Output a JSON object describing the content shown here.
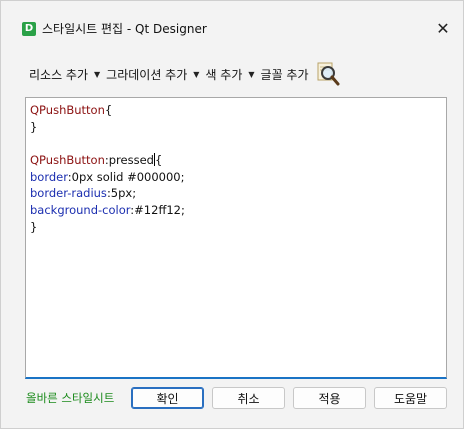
{
  "window": {
    "title": "스타일시트 편집 - Qt Designer",
    "app_icon_letter": "D",
    "close_glyph": "✕"
  },
  "toolbar": {
    "items": [
      {
        "label": "리소스 추가",
        "arrow": "▼"
      },
      {
        "label": "그라데이션 추가",
        "arrow": "▼"
      },
      {
        "label": "색 추가",
        "arrow": "▼"
      },
      {
        "label": "글꼴 추가"
      }
    ],
    "magnifier_icon": "magnifier-icon"
  },
  "editor": {
    "lines": [
      [
        {
          "t": "QPushButton",
          "k": "sel"
        },
        {
          "t": "{",
          "k": "val"
        }
      ],
      [
        {
          "t": "}",
          "k": "val"
        }
      ],
      [],
      [
        {
          "t": "QPushButton",
          "k": "sel"
        },
        {
          "t": ":pressed",
          "k": "val"
        },
        {
          "t": "{",
          "k": "val"
        }
      ],
      [
        {
          "t": "border",
          "k": "prop"
        },
        {
          "t": ":0px solid #000000;",
          "k": "val"
        }
      ],
      [
        {
          "t": "border-radius",
          "k": "prop"
        },
        {
          "t": ":5px;",
          "k": "val"
        }
      ],
      [
        {
          "t": "background-color",
          "k": "prop"
        },
        {
          "t": ":#12ff12;",
          "k": "val"
        }
      ],
      [
        {
          "t": "}",
          "k": "val"
        }
      ]
    ]
  },
  "footer": {
    "status": "올바른 스타일시트",
    "ok_label": "확인",
    "cancel_label": "취소",
    "apply_label": "적용",
    "help_label": "도움말"
  },
  "colors": {
    "selector": "#8b1010",
    "property": "#1c2fb0",
    "status_ok": "#1a8a1a",
    "focus": "#1a73c5",
    "app_icon": "#2aa147"
  }
}
